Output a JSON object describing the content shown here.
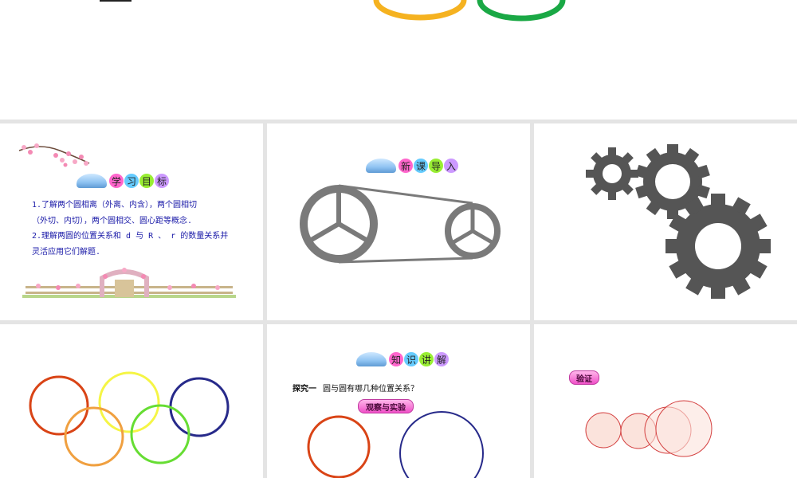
{
  "slides": {
    "objectives": {
      "badge": [
        "学",
        "习",
        "目",
        "标"
      ],
      "lines": [
        "1.了解两个圆相离（外离、内含），两个圆相切",
        "（外切、内切），两个圆相交、圆心距等概念.",
        "2.理解两圆的位置关系和 d 与 R 、 r  的数量关系并",
        "灵活应用它们解题."
      ]
    },
    "intro": {
      "badge": [
        "新",
        "课",
        "导",
        "入"
      ]
    },
    "knowledge": {
      "badge": [
        "知",
        "识",
        "讲",
        "解"
      ],
      "explore_label": "探究一",
      "explore_question": "圆与圆有哪几种位置关系？",
      "button": "观察与实验"
    },
    "verify": {
      "button": "验证"
    }
  },
  "colors": {
    "badge_pills": [
      "#ff66cc",
      "#66ccff",
      "#99ee33",
      "#cc99ff"
    ],
    "ring_red": "#d94416",
    "ring_yellow": "#f5f545",
    "ring_blue": "#272a8a",
    "ring_orange": "#f0a040",
    "ring_green": "#66dd33",
    "gear": "#555555",
    "pulley": "#7a7a7a",
    "objective_text": "#1a1aa8"
  },
  "icons": [
    "flower-branch-icon",
    "garden-fence-icon",
    "book-icon",
    "gear-icon",
    "pulley-icon"
  ]
}
